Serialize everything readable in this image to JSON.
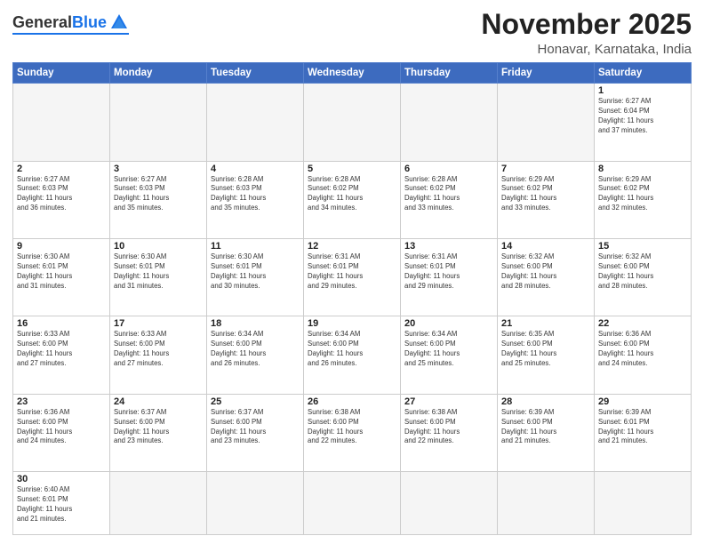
{
  "logo": {
    "general": "General",
    "blue": "Blue"
  },
  "title": "November 2025",
  "location": "Honavar, Karnataka, India",
  "days_of_week": [
    "Sunday",
    "Monday",
    "Tuesday",
    "Wednesday",
    "Thursday",
    "Friday",
    "Saturday"
  ],
  "weeks": [
    [
      {
        "day": "",
        "info": ""
      },
      {
        "day": "",
        "info": ""
      },
      {
        "day": "",
        "info": ""
      },
      {
        "day": "",
        "info": ""
      },
      {
        "day": "",
        "info": ""
      },
      {
        "day": "",
        "info": ""
      },
      {
        "day": "1",
        "info": "Sunrise: 6:27 AM\nSunset: 6:04 PM\nDaylight: 11 hours\nand 37 minutes."
      }
    ],
    [
      {
        "day": "2",
        "info": "Sunrise: 6:27 AM\nSunset: 6:03 PM\nDaylight: 11 hours\nand 36 minutes."
      },
      {
        "day": "3",
        "info": "Sunrise: 6:27 AM\nSunset: 6:03 PM\nDaylight: 11 hours\nand 35 minutes."
      },
      {
        "day": "4",
        "info": "Sunrise: 6:28 AM\nSunset: 6:03 PM\nDaylight: 11 hours\nand 35 minutes."
      },
      {
        "day": "5",
        "info": "Sunrise: 6:28 AM\nSunset: 6:02 PM\nDaylight: 11 hours\nand 34 minutes."
      },
      {
        "day": "6",
        "info": "Sunrise: 6:28 AM\nSunset: 6:02 PM\nDaylight: 11 hours\nand 33 minutes."
      },
      {
        "day": "7",
        "info": "Sunrise: 6:29 AM\nSunset: 6:02 PM\nDaylight: 11 hours\nand 33 minutes."
      },
      {
        "day": "8",
        "info": "Sunrise: 6:29 AM\nSunset: 6:02 PM\nDaylight: 11 hours\nand 32 minutes."
      }
    ],
    [
      {
        "day": "9",
        "info": "Sunrise: 6:30 AM\nSunset: 6:01 PM\nDaylight: 11 hours\nand 31 minutes."
      },
      {
        "day": "10",
        "info": "Sunrise: 6:30 AM\nSunset: 6:01 PM\nDaylight: 11 hours\nand 31 minutes."
      },
      {
        "day": "11",
        "info": "Sunrise: 6:30 AM\nSunset: 6:01 PM\nDaylight: 11 hours\nand 30 minutes."
      },
      {
        "day": "12",
        "info": "Sunrise: 6:31 AM\nSunset: 6:01 PM\nDaylight: 11 hours\nand 29 minutes."
      },
      {
        "day": "13",
        "info": "Sunrise: 6:31 AM\nSunset: 6:01 PM\nDaylight: 11 hours\nand 29 minutes."
      },
      {
        "day": "14",
        "info": "Sunrise: 6:32 AM\nSunset: 6:00 PM\nDaylight: 11 hours\nand 28 minutes."
      },
      {
        "day": "15",
        "info": "Sunrise: 6:32 AM\nSunset: 6:00 PM\nDaylight: 11 hours\nand 28 minutes."
      }
    ],
    [
      {
        "day": "16",
        "info": "Sunrise: 6:33 AM\nSunset: 6:00 PM\nDaylight: 11 hours\nand 27 minutes."
      },
      {
        "day": "17",
        "info": "Sunrise: 6:33 AM\nSunset: 6:00 PM\nDaylight: 11 hours\nand 27 minutes."
      },
      {
        "day": "18",
        "info": "Sunrise: 6:34 AM\nSunset: 6:00 PM\nDaylight: 11 hours\nand 26 minutes."
      },
      {
        "day": "19",
        "info": "Sunrise: 6:34 AM\nSunset: 6:00 PM\nDaylight: 11 hours\nand 26 minutes."
      },
      {
        "day": "20",
        "info": "Sunrise: 6:34 AM\nSunset: 6:00 PM\nDaylight: 11 hours\nand 25 minutes."
      },
      {
        "day": "21",
        "info": "Sunrise: 6:35 AM\nSunset: 6:00 PM\nDaylight: 11 hours\nand 25 minutes."
      },
      {
        "day": "22",
        "info": "Sunrise: 6:36 AM\nSunset: 6:00 PM\nDaylight: 11 hours\nand 24 minutes."
      }
    ],
    [
      {
        "day": "23",
        "info": "Sunrise: 6:36 AM\nSunset: 6:00 PM\nDaylight: 11 hours\nand 24 minutes."
      },
      {
        "day": "24",
        "info": "Sunrise: 6:37 AM\nSunset: 6:00 PM\nDaylight: 11 hours\nand 23 minutes."
      },
      {
        "day": "25",
        "info": "Sunrise: 6:37 AM\nSunset: 6:00 PM\nDaylight: 11 hours\nand 23 minutes."
      },
      {
        "day": "26",
        "info": "Sunrise: 6:38 AM\nSunset: 6:00 PM\nDaylight: 11 hours\nand 22 minutes."
      },
      {
        "day": "27",
        "info": "Sunrise: 6:38 AM\nSunset: 6:00 PM\nDaylight: 11 hours\nand 22 minutes."
      },
      {
        "day": "28",
        "info": "Sunrise: 6:39 AM\nSunset: 6:00 PM\nDaylight: 11 hours\nand 21 minutes."
      },
      {
        "day": "29",
        "info": "Sunrise: 6:39 AM\nSunset: 6:01 PM\nDaylight: 11 hours\nand 21 minutes."
      }
    ],
    [
      {
        "day": "30",
        "info": "Sunrise: 6:40 AM\nSunset: 6:01 PM\nDaylight: 11 hours\nand 21 minutes."
      },
      {
        "day": "",
        "info": ""
      },
      {
        "day": "",
        "info": ""
      },
      {
        "day": "",
        "info": ""
      },
      {
        "day": "",
        "info": ""
      },
      {
        "day": "",
        "info": ""
      },
      {
        "day": "",
        "info": ""
      }
    ]
  ]
}
